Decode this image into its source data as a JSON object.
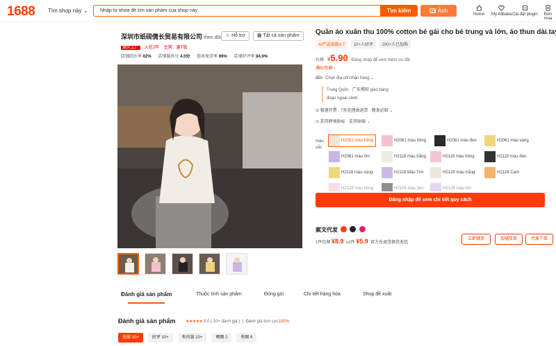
{
  "header": {
    "logo": "1688",
    "shop_dropdown": "Tìm shop này",
    "search_placeholder": "Nhập từ khóa để tìm sản phẩm của shop này",
    "search_button": "Tìm kiếm",
    "image_button": "Ảnh",
    "nav": [
      "Home",
      "My Alibaba",
      "Cài đặt plugin",
      "Đơn mua"
    ]
  },
  "seller": {
    "name": "深圳市纸砚倩长贸易有限公司",
    "follow": "theo dõi",
    "support_button": "Hỗ trợ",
    "all_products_button": "Tất cả sản phẩm",
    "tag_badge": "源头工厂",
    "tag_year": "入驻2年",
    "tag_main": "主营：童T恤",
    "stats": [
      {
        "label": "店铺回头率",
        "value": "62%"
      },
      {
        "label": "店铺服务分",
        "value": "4.0分"
      },
      {
        "label": "揽收发货率",
        "value": "99%"
      },
      {
        "label": "店铺好评率",
        "value": "84.9%"
      }
    ]
  },
  "product": {
    "title": "Quần áo xuân thu 100% cotton bé gái cho bé trung và lớn, áo thun dài tay.",
    "badges": [
      "AI严选指数4.7",
      "10+人好评",
      "200+人已加购"
    ],
    "price_label": "价格",
    "price_currency": "¥",
    "price_value": "5.90",
    "price_note": "Đăng nhập để xem thêm ưu đãi",
    "free_ship": "满50包邮",
    "ship_to_label": "đến",
    "ship_to_value": "Chọn địa chỉ nhận hàng",
    "ship_from": "Trung Quốc · 广东揭阳 giao hàng",
    "ship_overseas": "đoạn ngoại cảnh:",
    "service_row_1": "极速开票 · 7天无理由退货 · 晚发必赔",
    "service_row_2": "支持跨境贴标 · 支持贴唛",
    "color_label": "màu sắc",
    "variants": [
      "H2061 màu trắng",
      "H2061 màu hồng",
      "H2061 màu đen",
      "H2061 màu vàng",
      "H2061 màu tím",
      "H2118 màu trắng",
      "H2118 màu hồng",
      "H2118 màu đen",
      "H2118 màu vàng",
      "H2118 Màu Tím",
      "H2128 màu trắng",
      "H2128 Cam",
      "H2128 màu hồng",
      "H2128 màu đen",
      "H2128 màu tím"
    ],
    "login_button": "Đăng nhập để xem chi tiết quy cách"
  },
  "agent": {
    "title": "案文代发",
    "price_1_label": "1件包邮",
    "price_1": "¥8.9",
    "price_2_label": "≥2件",
    "price_2": "¥5.9",
    "note": "官方仓退货换货无忧",
    "buttons": [
      "立即铺货",
      "加铺货单",
      "代发下单"
    ]
  },
  "tabs": [
    "Đánh giá sản phẩm",
    "Thuộc tính sản phẩm",
    "Đóng gói",
    "Chi tiết hàng hóa",
    "Shop đề xuất"
  ],
  "reviews": {
    "heading": "Đánh giá sản phẩm",
    "stars": "★★★★★",
    "score": "5.0",
    "count": "( 10+ đánh giá )",
    "positive_label": "Đánh giá tích cực",
    "positive_pct": "100%",
    "filters": [
      "全部 10+",
      "好评 10+",
      "有内容 10+",
      "晒图 2",
      "有图 6"
    ]
  },
  "colors": {
    "brand": "#ff5a00",
    "price": "#ff3300"
  }
}
